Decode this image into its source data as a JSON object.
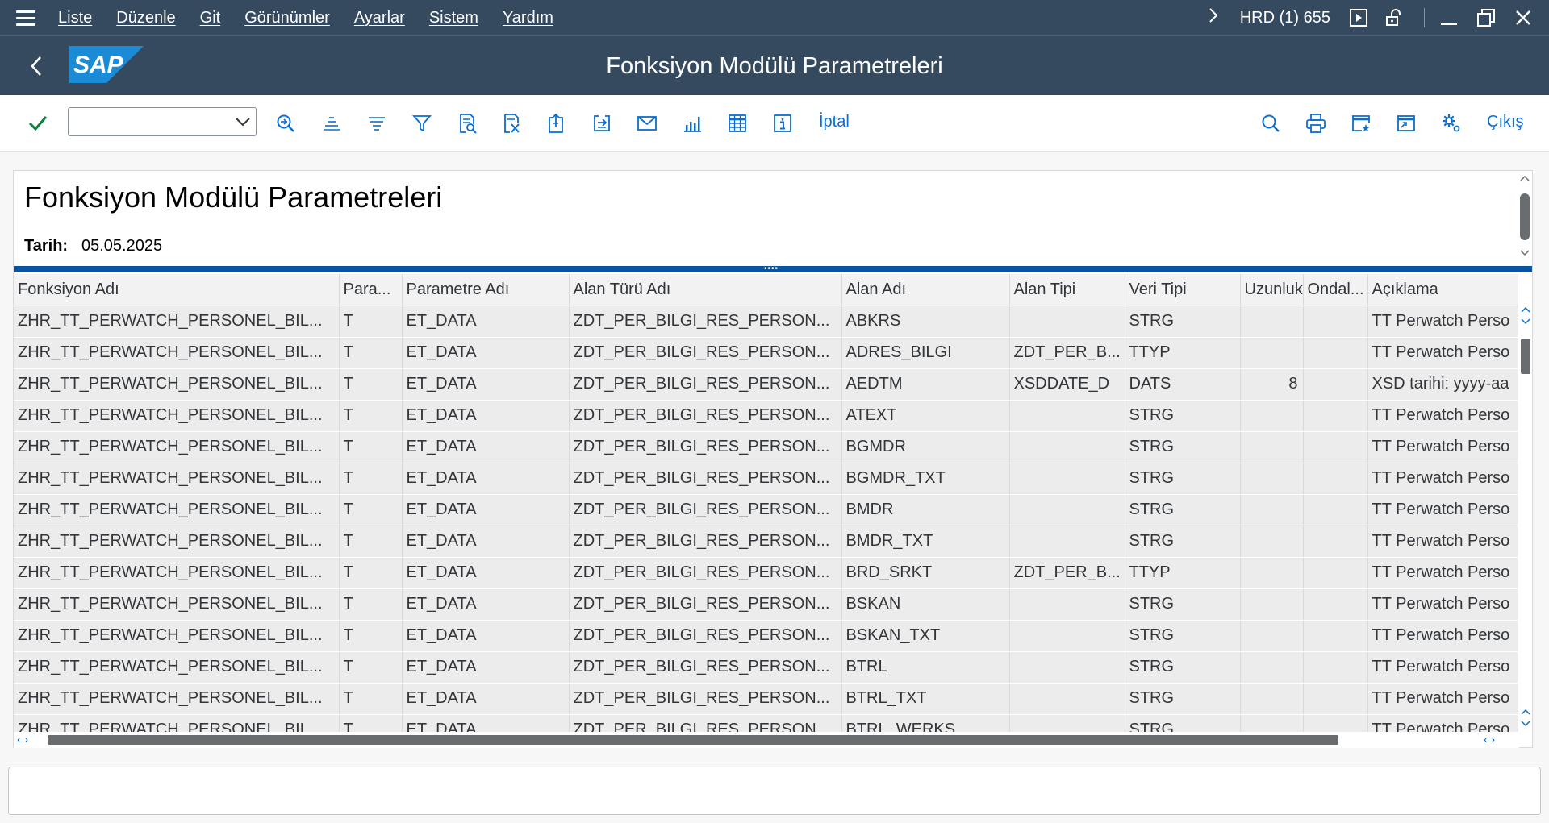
{
  "menu": {
    "items": [
      "Liste",
      "Düzenle",
      "Git",
      "Görünümler",
      "Ayarlar",
      "Sistem",
      "Yardım"
    ],
    "system_info": "HRD (1) 655"
  },
  "header": {
    "logo": "SAP",
    "title": "Fonksiyon Modülü Parametreleri"
  },
  "toolbar": {
    "command_field": {
      "value": "",
      "placeholder": ""
    },
    "cancel_label": "İptal",
    "exit_label": "Çıkış"
  },
  "report": {
    "title": "Fonksiyon Modülü Parametreleri",
    "date_label": "Tarih:",
    "date_value": "05.05.2025"
  },
  "table": {
    "columns": [
      "Fonksiyon Adı",
      "Para...",
      "Parametre Adı",
      "Alan Türü Adı",
      "Alan Adı",
      "Alan Tipi",
      "Veri Tipi",
      "Uzunluk",
      "Ondal...",
      "Açıklama"
    ],
    "rows": [
      [
        "ZHR_TT_PERWATCH_PERSONEL_BIL...",
        "T",
        "ET_DATA",
        "ZDT_PER_BILGI_RES_PERSON...",
        "ABKRS",
        "",
        "STRG",
        "",
        "",
        "TT Perwatch Perso"
      ],
      [
        "ZHR_TT_PERWATCH_PERSONEL_BIL...",
        "T",
        "ET_DATA",
        "ZDT_PER_BILGI_RES_PERSON...",
        "ADRES_BILGI",
        "ZDT_PER_B...",
        "TTYP",
        "",
        "",
        "TT Perwatch Perso"
      ],
      [
        "ZHR_TT_PERWATCH_PERSONEL_BIL...",
        "T",
        "ET_DATA",
        "ZDT_PER_BILGI_RES_PERSON...",
        "AEDTM",
        "XSDDATE_D",
        "DATS",
        "8",
        "",
        "XSD tarihi: yyyy-aa"
      ],
      [
        "ZHR_TT_PERWATCH_PERSONEL_BIL...",
        "T",
        "ET_DATA",
        "ZDT_PER_BILGI_RES_PERSON...",
        "ATEXT",
        "",
        "STRG",
        "",
        "",
        "TT Perwatch Perso"
      ],
      [
        "ZHR_TT_PERWATCH_PERSONEL_BIL...",
        "T",
        "ET_DATA",
        "ZDT_PER_BILGI_RES_PERSON...",
        "BGMDR",
        "",
        "STRG",
        "",
        "",
        "TT Perwatch Perso"
      ],
      [
        "ZHR_TT_PERWATCH_PERSONEL_BIL...",
        "T",
        "ET_DATA",
        "ZDT_PER_BILGI_RES_PERSON...",
        "BGMDR_TXT",
        "",
        "STRG",
        "",
        "",
        "TT Perwatch Perso"
      ],
      [
        "ZHR_TT_PERWATCH_PERSONEL_BIL...",
        "T",
        "ET_DATA",
        "ZDT_PER_BILGI_RES_PERSON...",
        "BMDR",
        "",
        "STRG",
        "",
        "",
        "TT Perwatch Perso"
      ],
      [
        "ZHR_TT_PERWATCH_PERSONEL_BIL...",
        "T",
        "ET_DATA",
        "ZDT_PER_BILGI_RES_PERSON...",
        "BMDR_TXT",
        "",
        "STRG",
        "",
        "",
        "TT Perwatch Perso"
      ],
      [
        "ZHR_TT_PERWATCH_PERSONEL_BIL...",
        "T",
        "ET_DATA",
        "ZDT_PER_BILGI_RES_PERSON...",
        "BRD_SRKT",
        "ZDT_PER_B...",
        "TTYP",
        "",
        "",
        "TT Perwatch Perso"
      ],
      [
        "ZHR_TT_PERWATCH_PERSONEL_BIL...",
        "T",
        "ET_DATA",
        "ZDT_PER_BILGI_RES_PERSON...",
        "BSKAN",
        "",
        "STRG",
        "",
        "",
        "TT Perwatch Perso"
      ],
      [
        "ZHR_TT_PERWATCH_PERSONEL_BIL...",
        "T",
        "ET_DATA",
        "ZDT_PER_BILGI_RES_PERSON...",
        "BSKAN_TXT",
        "",
        "STRG",
        "",
        "",
        "TT Perwatch Perso"
      ],
      [
        "ZHR_TT_PERWATCH_PERSONEL_BIL...",
        "T",
        "ET_DATA",
        "ZDT_PER_BILGI_RES_PERSON...",
        "BTRL",
        "",
        "STRG",
        "",
        "",
        "TT Perwatch Perso"
      ],
      [
        "ZHR_TT_PERWATCH_PERSONEL_BIL...",
        "T",
        "ET_DATA",
        "ZDT_PER_BILGI_RES_PERSON...",
        "BTRL_TXT",
        "",
        "STRG",
        "",
        "",
        "TT Perwatch Perso"
      ],
      [
        "ZHR_TT_PERWATCH_PERSONEL_BIL...",
        "T",
        "ET_DATA",
        "ZDT_PER_BILGI_RES_PERSON...",
        "BTRL_WERKS",
        "",
        "STRG",
        "",
        "",
        "TT Perwatch Perso"
      ]
    ]
  },
  "colors": {
    "shell": "#354a5f",
    "accent": "#0a6ed1",
    "splitter": "#0854a0",
    "check": "#107e3e",
    "logo_blue": "#1b8bd6"
  }
}
